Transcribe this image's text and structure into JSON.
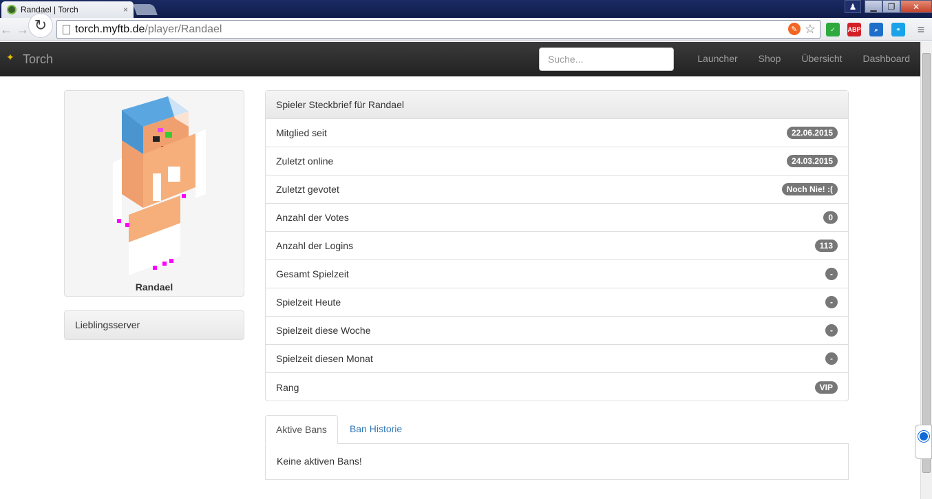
{
  "browser": {
    "tab_title": "Randael | Torch",
    "tab_close": "×",
    "url_host": "torch.myftb.de",
    "url_path": "/player/Randael",
    "window_buttons": {
      "minimize": "▁",
      "maximize": "❐",
      "close": "✕"
    },
    "extensions": [
      {
        "name": "checkmark-extension-icon",
        "label": "✓",
        "color": "#2eaa3c"
      },
      {
        "name": "adblock-plus-icon",
        "label": "ABP",
        "color": "#d32027"
      },
      {
        "name": "search-extension-icon",
        "label": "⌕",
        "color": "#1e6fc9"
      },
      {
        "name": "share-extension-icon",
        "label": "⚭",
        "color": "#1aa3e8"
      },
      {
        "name": "chrome-menu-icon",
        "label": "≡",
        "color": "#666666"
      }
    ]
  },
  "navbar": {
    "brand": "Torch",
    "search_placeholder": "Suche...",
    "links": [
      "Launcher",
      "Shop",
      "Übersicht",
      "Dashboard"
    ]
  },
  "player": {
    "name": "Randael",
    "favorite_server_heading": "Lieblingsserver"
  },
  "profile": {
    "heading": "Spieler Steckbrief für Randael",
    "rows": [
      {
        "label": "Mitglied seit",
        "value": "22.06.2015"
      },
      {
        "label": "Zuletzt online",
        "value": "24.03.2015"
      },
      {
        "label": "Zuletzt gevotet",
        "value": "Noch Nie! :("
      },
      {
        "label": "Anzahl der Votes",
        "value": "0"
      },
      {
        "label": "Anzahl der Logins",
        "value": "113"
      },
      {
        "label": "Gesamt Spielzeit",
        "value": "-"
      },
      {
        "label": "Spielzeit Heute",
        "value": "-"
      },
      {
        "label": "Spielzeit diese Woche",
        "value": "-"
      },
      {
        "label": "Spielzeit diesen Monat",
        "value": "-"
      },
      {
        "label": "Rang",
        "value": "VIP"
      }
    ]
  },
  "bans": {
    "tabs": [
      "Aktive Bans",
      "Ban Historie"
    ],
    "active_message": "Keine aktiven Bans!"
  }
}
